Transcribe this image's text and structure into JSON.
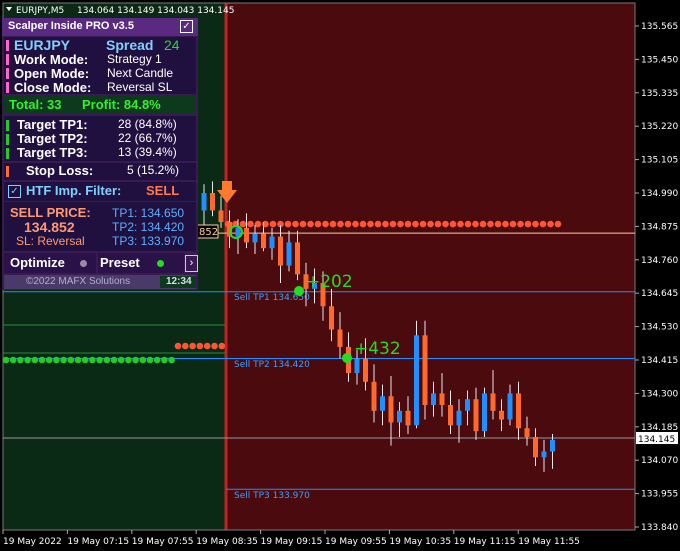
{
  "header": {
    "symbol": "EURJPY,M5",
    "ohlc": "134.064 134.149 134.043 134.145"
  },
  "panel": {
    "title": "Scalper Inside PRO v3.5",
    "symbol": "EURJPY",
    "spread_label": "Spread",
    "spread_value": "24",
    "work_mode_label": "Work Mode:",
    "work_mode_value": "Strategy 1",
    "open_mode_label": "Open Mode:",
    "open_mode_value": "Next Candle",
    "close_mode_label": "Close Mode:",
    "close_mode_value": "Reversal SL",
    "total": "Total: 33",
    "profit": "Profit: 84.8%",
    "targets": [
      {
        "label": "Target TP1:",
        "value": "28 (84.8%)"
      },
      {
        "label": "Target TP2:",
        "value": "22 (66.7%)"
      },
      {
        "label": "Target TP3:",
        "value": "13 (39.4%)"
      }
    ],
    "stop_loss_label": "Stop Loss:",
    "stop_loss_value": "5 (15.2%)",
    "htf_label": "HTF Imp. Filter:",
    "htf_value": "SELL",
    "sell_price_label": "SELL PRICE:",
    "sell_price_value": "134.852",
    "sl_text": "SL: Reversal",
    "tp1": "TP1: 134.650",
    "tp2": "TP2: 134.420",
    "tp3": "TP3: 133.970",
    "optimize_label": "Optimize",
    "preset_label": "Preset",
    "copyright": "©2022 MAFX Solutions",
    "clock": "12:34"
  },
  "chart": {
    "price_labels": [
      "135.565",
      "135.450",
      "135.335",
      "135.220",
      "135.105",
      "134.990",
      "134.875",
      "134.760",
      "134.645",
      "134.530",
      "134.415",
      "134.300",
      "134.185",
      "134.070",
      "133.955",
      "133.840"
    ],
    "current_price": "134.145",
    "time_labels": [
      "19 May 2022",
      "19 May 07:15",
      "19 May 07:55",
      "19 May 08:35",
      "19 May 09:15",
      "19 May 09:55",
      "19 May 10:35",
      "19 May 11:15",
      "19 May 11:55"
    ],
    "entry_label": "852",
    "tp1_line_label": "Sell TP1 134.650",
    "tp2_line_label": "Sell TP2 134.420",
    "tp3_line_label": "Sell TP3 133.970",
    "hit1_label": "+202",
    "hit2_label": "+432",
    "colors": {
      "bull": "#1e90ff",
      "bear": "#ff6a2a",
      "green_zone": "#0a2a16",
      "red_zone": "#4a0a0e",
      "dots_red": "#ff5533",
      "dots_green": "#22cc22"
    }
  },
  "chart_data": {
    "type": "candlestick",
    "y_range": [
      133.84,
      135.565
    ],
    "levels": {
      "entry": 134.852,
      "tp1": 134.65,
      "tp2": 134.42,
      "tp3": 133.97,
      "current": 134.145
    },
    "candles": [
      {
        "o": 134.93,
        "h": 135.02,
        "l": 134.87,
        "c": 134.99
      },
      {
        "o": 134.99,
        "h": 135.03,
        "l": 134.91,
        "c": 134.93
      },
      {
        "o": 134.93,
        "h": 134.98,
        "l": 134.87,
        "c": 134.89
      },
      {
        "o": 134.89,
        "h": 134.93,
        "l": 134.8,
        "c": 134.84
      },
      {
        "o": 134.84,
        "h": 134.9,
        "l": 134.78,
        "c": 134.87
      },
      {
        "o": 134.87,
        "h": 134.92,
        "l": 134.8,
        "c": 134.82
      },
      {
        "o": 134.82,
        "h": 134.88,
        "l": 134.78,
        "c": 134.85
      },
      {
        "o": 134.85,
        "h": 134.89,
        "l": 134.79,
        "c": 134.8
      },
      {
        "o": 134.8,
        "h": 134.87,
        "l": 134.76,
        "c": 134.84
      },
      {
        "o": 134.84,
        "h": 134.88,
        "l": 134.68,
        "c": 134.74
      },
      {
        "o": 134.74,
        "h": 134.86,
        "l": 134.72,
        "c": 134.82
      },
      {
        "o": 134.82,
        "h": 134.86,
        "l": 134.69,
        "c": 134.71
      },
      {
        "o": 134.71,
        "h": 134.75,
        "l": 134.6,
        "c": 134.66
      },
      {
        "o": 134.66,
        "h": 134.73,
        "l": 134.61,
        "c": 134.68
      },
      {
        "o": 134.68,
        "h": 134.72,
        "l": 134.55,
        "c": 134.6
      },
      {
        "o": 134.6,
        "h": 134.66,
        "l": 134.48,
        "c": 134.52
      },
      {
        "o": 134.52,
        "h": 134.58,
        "l": 134.42,
        "c": 134.46
      },
      {
        "o": 134.46,
        "h": 134.51,
        "l": 134.34,
        "c": 134.37
      },
      {
        "o": 134.37,
        "h": 134.45,
        "l": 134.33,
        "c": 134.42
      },
      {
        "o": 134.42,
        "h": 134.49,
        "l": 134.31,
        "c": 134.34
      },
      {
        "o": 134.34,
        "h": 134.4,
        "l": 134.2,
        "c": 134.24
      },
      {
        "o": 134.24,
        "h": 134.33,
        "l": 134.19,
        "c": 134.29
      },
      {
        "o": 134.29,
        "h": 134.36,
        "l": 134.12,
        "c": 134.2
      },
      {
        "o": 134.2,
        "h": 134.27,
        "l": 134.15,
        "c": 134.24
      },
      {
        "o": 134.24,
        "h": 134.29,
        "l": 134.16,
        "c": 134.19
      },
      {
        "o": 134.19,
        "h": 134.55,
        "l": 134.18,
        "c": 134.5
      },
      {
        "o": 134.5,
        "h": 134.55,
        "l": 134.21,
        "c": 134.26
      },
      {
        "o": 134.26,
        "h": 134.34,
        "l": 134.22,
        "c": 134.3
      },
      {
        "o": 134.3,
        "h": 134.37,
        "l": 134.22,
        "c": 134.26
      },
      {
        "o": 134.26,
        "h": 134.31,
        "l": 134.16,
        "c": 134.19
      },
      {
        "o": 134.19,
        "h": 134.28,
        "l": 134.13,
        "c": 134.24
      },
      {
        "o": 134.24,
        "h": 134.31,
        "l": 134.19,
        "c": 134.28
      },
      {
        "o": 134.28,
        "h": 134.32,
        "l": 134.14,
        "c": 134.17
      },
      {
        "o": 134.17,
        "h": 134.32,
        "l": 134.15,
        "c": 134.3
      },
      {
        "o": 134.3,
        "h": 134.38,
        "l": 134.21,
        "c": 134.24
      },
      {
        "o": 134.24,
        "h": 134.28,
        "l": 134.17,
        "c": 134.21
      },
      {
        "o": 134.21,
        "h": 134.33,
        "l": 134.19,
        "c": 134.3
      },
      {
        "o": 134.3,
        "h": 134.34,
        "l": 134.14,
        "c": 134.18
      },
      {
        "o": 134.18,
        "h": 134.22,
        "l": 134.12,
        "c": 134.15
      },
      {
        "o": 134.15,
        "h": 134.18,
        "l": 134.05,
        "c": 134.08
      },
      {
        "o": 134.08,
        "h": 134.14,
        "l": 134.03,
        "c": 134.1
      },
      {
        "o": 134.1,
        "h": 134.16,
        "l": 134.04,
        "c": 134.14
      }
    ]
  }
}
